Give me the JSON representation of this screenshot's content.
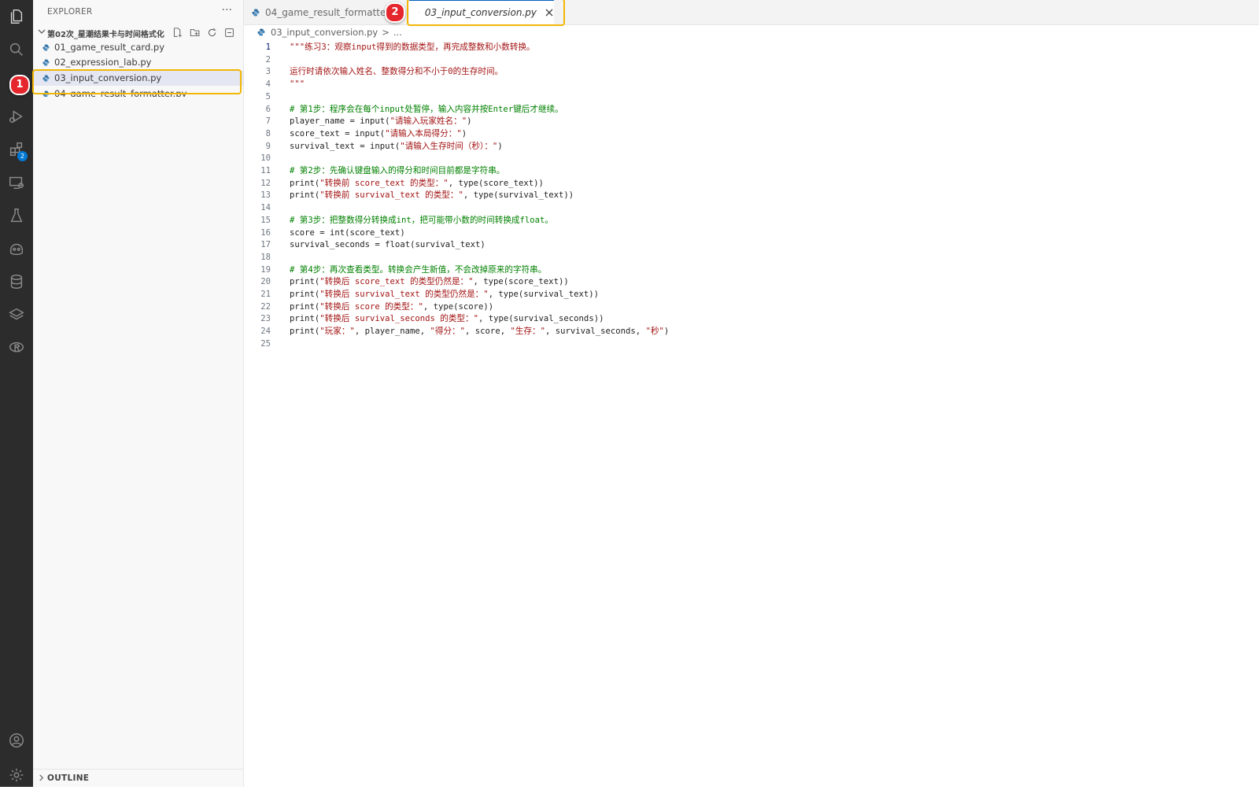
{
  "explorer": {
    "header": "EXPLORER",
    "more": "···",
    "folder": "第02次_星潮结果卡与时间格式化",
    "files": [
      {
        "name": "01_game_result_card.py"
      },
      {
        "name": "02_expression_lab.py"
      },
      {
        "name": "03_input_conversion.py"
      },
      {
        "name": "04_game_result_formatter.py"
      }
    ],
    "outline": "OUTLINE"
  },
  "activity": {
    "extensions_badge": "2"
  },
  "markers": {
    "one": "1",
    "two": "2"
  },
  "tabs": [
    {
      "label": "04_game_result_formatter.py"
    },
    {
      "label": "03_input_conversion.py"
    }
  ],
  "breadcrumb": {
    "file": "03_input_conversion.py",
    "sep": ">",
    "rest": "..."
  },
  "editor": {
    "lines": [
      {
        "n": "1",
        "text": "\"\"\"练习3：观察input得到的数据类型，再完成整数和小数转换。"
      },
      {
        "n": "2",
        "text": ""
      },
      {
        "n": "3",
        "text": "运行时请依次输入姓名、整数得分和不小于0的生存时间。"
      },
      {
        "n": "4",
        "text": "\"\"\""
      },
      {
        "n": "5",
        "text": ""
      },
      {
        "n": "6",
        "text": "# 第1步：程序会在每个input处暂停，输入内容并按Enter键后才继续。"
      },
      {
        "n": "7",
        "text": "player_name = input(\"请输入玩家姓名：\")"
      },
      {
        "n": "8",
        "text": "score_text = input(\"请输入本局得分：\")"
      },
      {
        "n": "9",
        "text": "survival_text = input(\"请输入生存时间（秒）：\")"
      },
      {
        "n": "10",
        "text": ""
      },
      {
        "n": "11",
        "text": "# 第2步：先确认键盘输入的得分和时间目前都是字符串。"
      },
      {
        "n": "12",
        "text": "print(\"转换前 score_text 的类型：\", type(score_text))"
      },
      {
        "n": "13",
        "text": "print(\"转换前 survival_text 的类型：\", type(survival_text))"
      },
      {
        "n": "14",
        "text": ""
      },
      {
        "n": "15",
        "text": "# 第3步：把整数得分转换成int，把可能带小数的时间转换成float。"
      },
      {
        "n": "16",
        "text": "score = int(score_text)"
      },
      {
        "n": "17",
        "text": "survival_seconds = float(survival_text)"
      },
      {
        "n": "18",
        "text": ""
      },
      {
        "n": "19",
        "text": "# 第4步：再次查看类型。转换会产生新值，不会改掉原来的字符串。"
      },
      {
        "n": "20",
        "text": "print(\"转换后 score_text 的类型仍然是：\", type(score_text))"
      },
      {
        "n": "21",
        "text": "print(\"转换后 survival_text 的类型仍然是：\", type(survival_text))"
      },
      {
        "n": "22",
        "text": "print(\"转换后 score 的类型：\", type(score))"
      },
      {
        "n": "23",
        "text": "print(\"转换后 survival_seconds 的类型：\", type(survival_seconds))"
      },
      {
        "n": "24",
        "text": "print(\"玩家：\", player_name, \"得分：\", score, \"生存：\", survival_seconds, \"秒\")"
      },
      {
        "n": "25",
        "text": ""
      }
    ]
  }
}
